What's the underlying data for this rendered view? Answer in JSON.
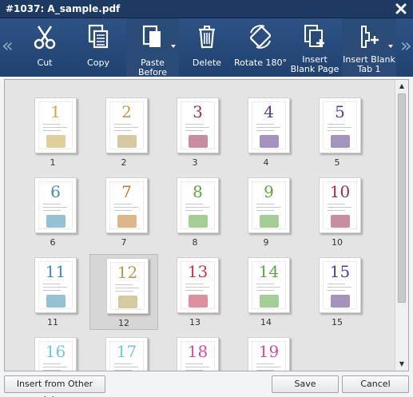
{
  "window": {
    "title": "#1037: A_sample.pdf"
  },
  "toolbar": {
    "tools": [
      {
        "key": "cut",
        "label": "Cut",
        "icon": "scissors-icon"
      },
      {
        "key": "copy",
        "label": "Copy",
        "icon": "copy-icon"
      },
      {
        "key": "paste-before",
        "label": "Paste Before",
        "icon": "paste-icon",
        "dropdown": true
      },
      {
        "key": "delete",
        "label": "Delete",
        "icon": "trash-icon"
      },
      {
        "key": "rotate-180",
        "label": "Rotate 180°",
        "icon": "rotate-icon"
      },
      {
        "key": "insert-blank-page",
        "label": "Insert Blank Page",
        "icon": "insert-page-icon"
      },
      {
        "key": "insert-blank-tab",
        "label": "Insert Blank Tab 1",
        "icon": "insert-tab-icon",
        "dropdown": true
      }
    ],
    "scroll_left": "«",
    "scroll_right": "»"
  },
  "pages": [
    {
      "n": "1",
      "color": "#c7a84d"
    },
    {
      "n": "2",
      "color": "#b59a53"
    },
    {
      "n": "3",
      "color": "#9b2f53"
    },
    {
      "n": "4",
      "color": "#5b3a8a"
    },
    {
      "n": "5",
      "color": "#5b3a8a"
    },
    {
      "n": "6",
      "color": "#3d8fb0"
    },
    {
      "n": "7",
      "color": "#c27a2a"
    },
    {
      "n": "8",
      "color": "#5aa63f"
    },
    {
      "n": "9",
      "color": "#5aa63f"
    },
    {
      "n": "10",
      "color": "#9b2f53"
    },
    {
      "n": "11",
      "color": "#3d8fb0"
    },
    {
      "n": "12",
      "color": "#b59a53"
    },
    {
      "n": "13",
      "color": "#c0364a"
    },
    {
      "n": "14",
      "color": "#5aa63f"
    },
    {
      "n": "15",
      "color": "#5b3a8a"
    },
    {
      "n": "16",
      "color": "#6fc7d4"
    },
    {
      "n": "17",
      "color": "#6fc7d4"
    },
    {
      "n": "18",
      "color": "#d24b9c"
    },
    {
      "n": "19",
      "color": "#d24b9c"
    }
  ],
  "captions": [
    "1",
    "2",
    "3",
    "4",
    "5",
    "6",
    "7",
    "8",
    "9",
    "10",
    "11",
    "12",
    "13",
    "14",
    "15"
  ],
  "selected_page": "12",
  "buttons": {
    "insert_other": "Insert from Other Job...",
    "save": "Save",
    "cancel": "Cancel"
  }
}
